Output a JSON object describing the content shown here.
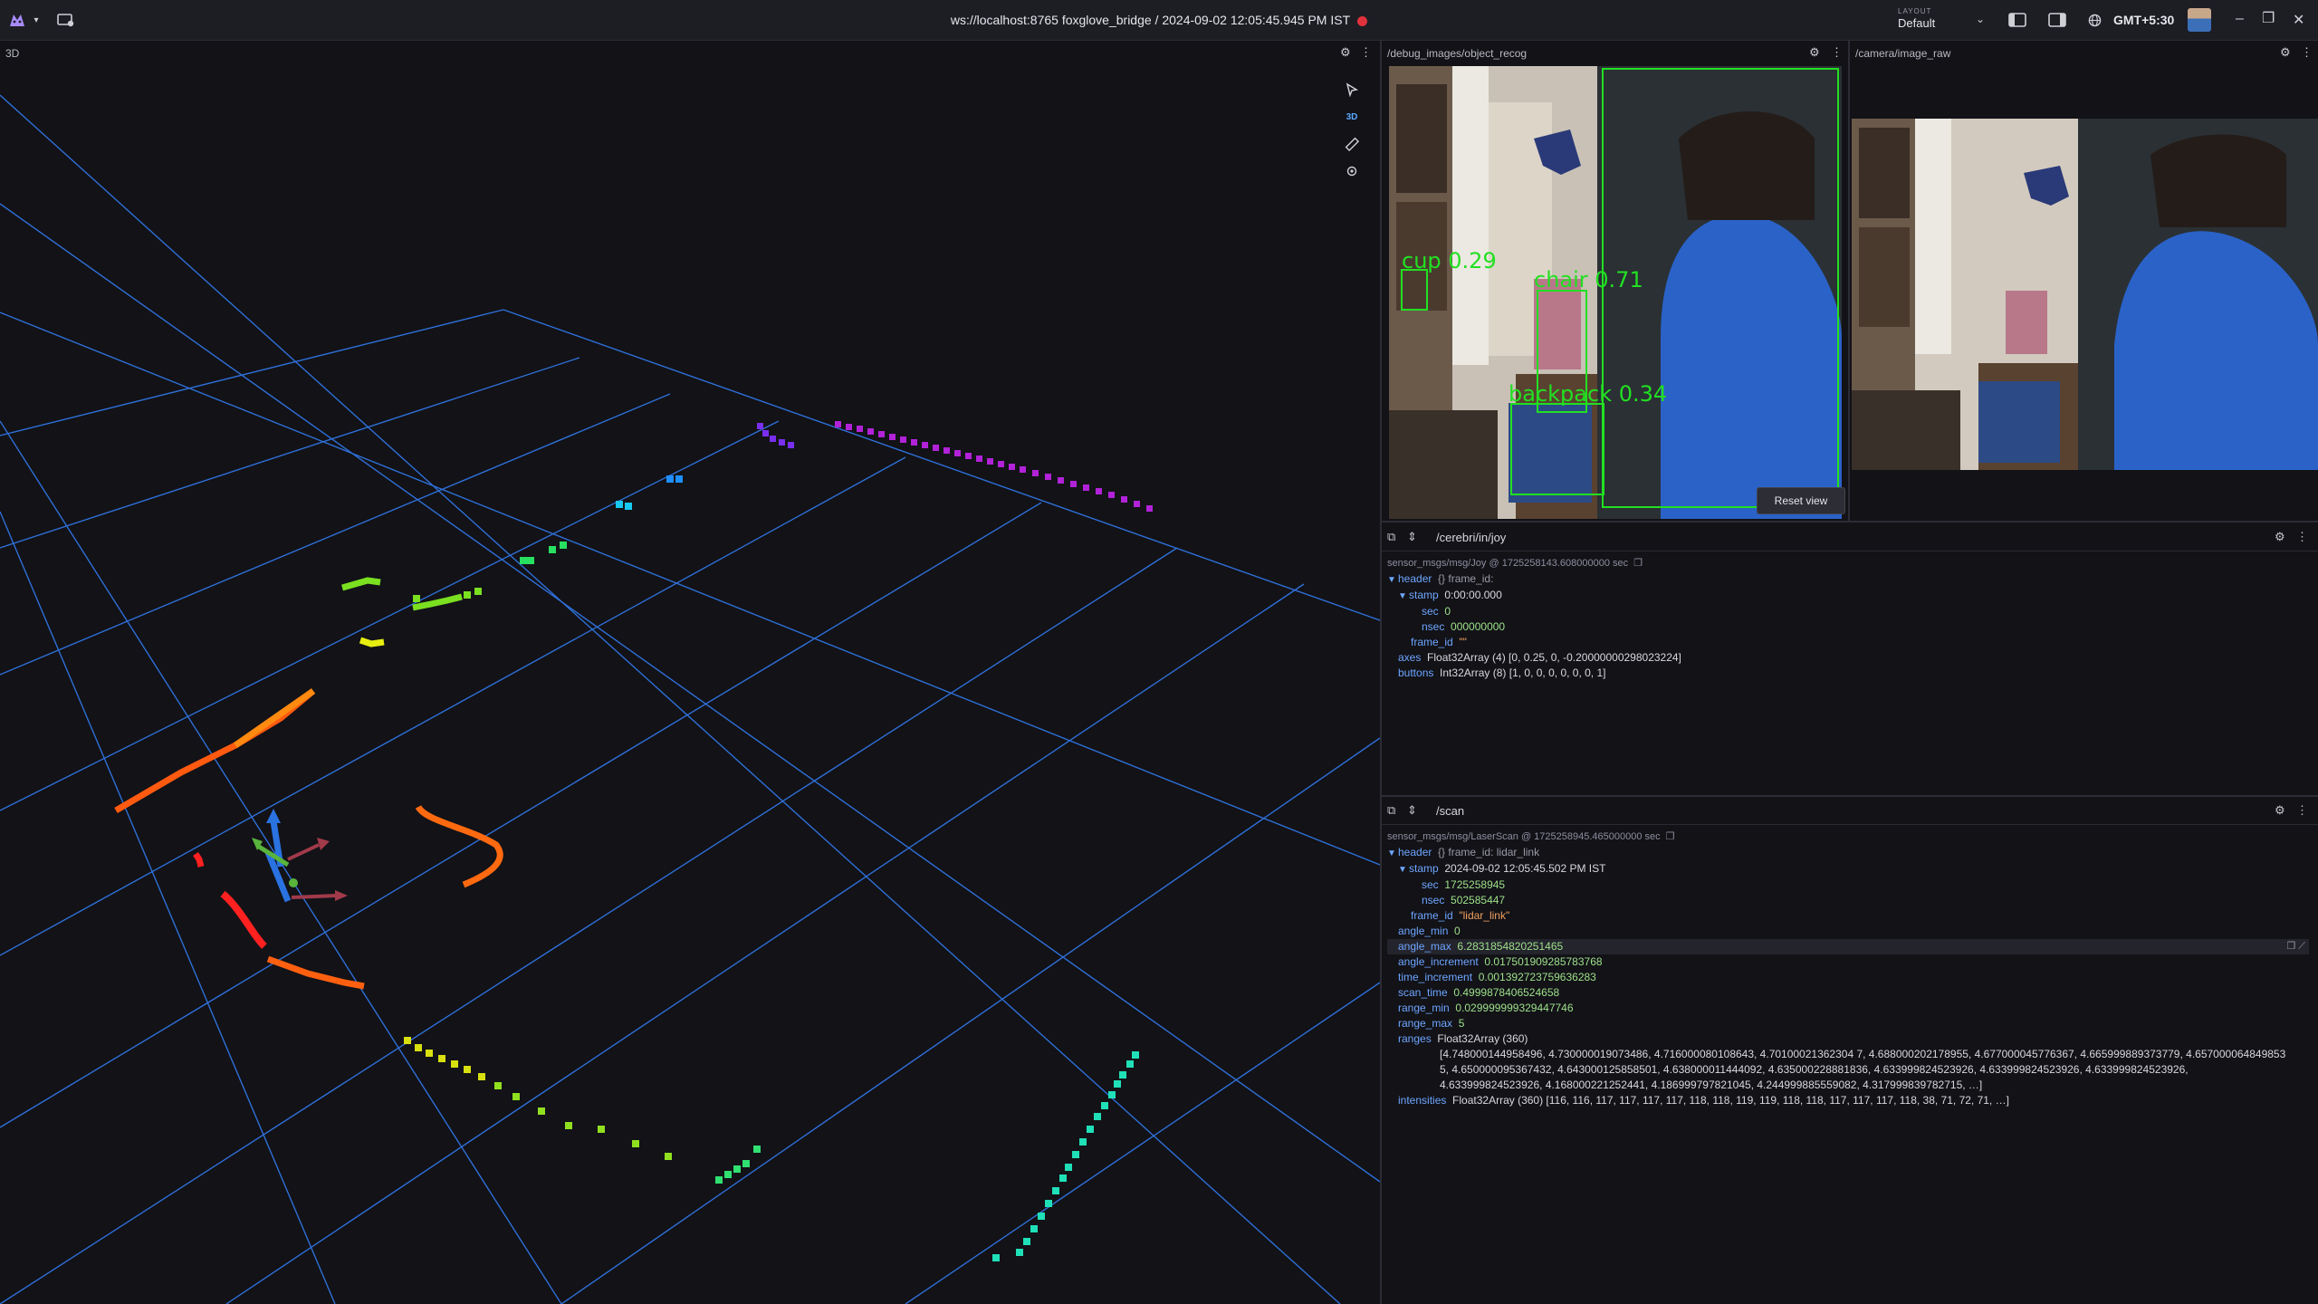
{
  "topbar": {
    "title": "ws://localhost:8765 foxglove_bridge / 2024-09-02 12:05:45.945 PM IST",
    "layout_label": "LAYOUT",
    "layout_value": "Default",
    "timezone": "GMT+5:30",
    "icons": [
      "foxglove-logo-icon",
      "chevron-down-icon",
      "app-menu-icon",
      "chevron-down-icon",
      "left-sidebar-icon",
      "right-sidebar-icon",
      "globe-icon",
      "minimize-icon",
      "maximize-icon",
      "close-icon"
    ]
  },
  "panel_3d": {
    "title": "3D",
    "tools": [
      "cursor-icon",
      "3D",
      "ruler-icon",
      "publish-point-icon"
    ]
  },
  "panel_obj": {
    "title": "/debug_images/object_recog",
    "detections": [
      {
        "label": "cup 0.29"
      },
      {
        "label": "chair 0.71"
      },
      {
        "label": "backpack 0.34"
      }
    ],
    "reset_label": "Reset view"
  },
  "panel_cam": {
    "title": "/camera/image_raw"
  },
  "panel_joy": {
    "topic": "/cerebri/in/joy",
    "meta": "sensor_msgs/msg/Joy @ 1725258143.608000000 sec",
    "header_key": "header",
    "header_summary": "{} frame_id:",
    "stamp_key": "stamp",
    "stamp_val": "0:00:00.000",
    "sec_key": "sec",
    "sec_val": "0",
    "nsec_key": "nsec",
    "nsec_val": "000000000",
    "frame_id_key": "frame_id",
    "frame_id_val": "\"\"",
    "axes_key": "axes",
    "axes_val": "Float32Array (4) [0, 0.25, 0, -0.20000000298023224]",
    "buttons_key": "buttons",
    "buttons_val": "Int32Array (8) [1, 0, 0, 0, 0, 0, 0, 1]"
  },
  "panel_scan": {
    "topic": "/scan",
    "meta": "sensor_msgs/msg/LaserScan @ 1725258945.465000000 sec",
    "header_key": "header",
    "header_summary": "{} frame_id: lidar_link",
    "stamp_key": "stamp",
    "stamp_val": "2024-09-02 12:05:45.502 PM IST",
    "sec_key": "sec",
    "sec_val": "1725258945",
    "nsec_key": "nsec",
    "nsec_val": "502585447",
    "frame_id_key": "frame_id",
    "frame_id_val": "\"lidar_link\"",
    "angle_min_key": "angle_min",
    "angle_min_val": "0",
    "angle_max_key": "angle_max",
    "angle_max_val": "6.2831854820251465",
    "angle_increment_key": "angle_increment",
    "angle_increment_val": "0.017501909285783768",
    "time_increment_key": "time_increment",
    "time_increment_val": "0.001392723759636283",
    "scan_time_key": "scan_time",
    "scan_time_val": "0.4999878406524658",
    "range_min_key": "range_min",
    "range_min_val": "0.029999999329447746",
    "range_max_key": "range_max",
    "range_max_val": "5",
    "ranges_key": "ranges",
    "ranges_type": "Float32Array (360)",
    "ranges_val": "[4.748000144958496, 4.730000019073486, 4.716000080108643, 4.70100021362304 7, 4.688000202178955, 4.677000045776367, 4.665999889373779, 4.657000064849853 5, 4.650000095367432, 4.643000125858501, 4.638000011444092, 4.635000228881836, 4.633999824523926, 4.633999824523926, 4.633999824523926, 4.633999824523926, 4.168000221252441, 4.186999797821045, 4.244999885559082, 4.317999839782715, …]",
    "intensities_key": "intensities",
    "intensities_val": "Float32Array (360) [116, 116, 117, 117, 117, 117, 118, 118, 119, 119, 118, 118, 117, 117, 117, 118, 38, 71, 72, 71, …]"
  }
}
